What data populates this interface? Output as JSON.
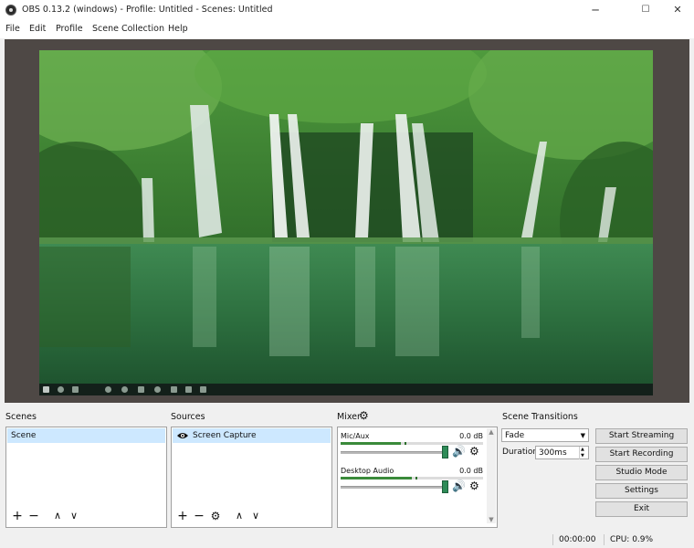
{
  "window": {
    "title": "OBS 0.13.2 (windows) - Profile: Untitled - Scenes: Untitled",
    "minimize": "─",
    "maximize": "☐",
    "close": "✕"
  },
  "menu": [
    "File",
    "Edit",
    "Profile",
    "Scene Collection",
    "Help"
  ],
  "docks": {
    "scenes": {
      "title": "Scenes",
      "items": [
        "Scene"
      ],
      "toolbar": {
        "add": "+",
        "remove": "−",
        "up": "∧",
        "down": "∨"
      }
    },
    "sources": {
      "title": "Sources",
      "items": [
        {
          "name": "Screen Capture",
          "visible_icon": "eye-icon"
        }
      ],
      "toolbar": {
        "add": "+",
        "remove": "−",
        "properties": "⚙",
        "up": "∧",
        "down": "∨"
      }
    },
    "mixer": {
      "title": "Mixer",
      "tracks": [
        {
          "name": "Mic/Aux",
          "db": "0.0 dB",
          "level": 0.42,
          "volume": 1.0
        },
        {
          "name": "Desktop Audio",
          "db": "0.0 dB",
          "level": 0.5,
          "volume": 1.0
        }
      ],
      "speaker_icon": "🔊",
      "gear_icon": "⚙"
    },
    "transitions": {
      "title": "Scene Transitions",
      "selected": "Fade",
      "duration_label": "Duration",
      "duration_value": "300ms"
    },
    "controls": {
      "start_streaming": "Start Streaming",
      "start_recording": "Start Recording",
      "studio_mode": "Studio Mode",
      "settings": "Settings",
      "exit": "Exit"
    }
  },
  "status": {
    "time": "00:00:00",
    "cpu": "CPU: 0.9%"
  },
  "colors": {
    "preview_bg": "#4e4845",
    "selected_row": "#cde8ff",
    "meter_green": "#3a8a3a"
  }
}
